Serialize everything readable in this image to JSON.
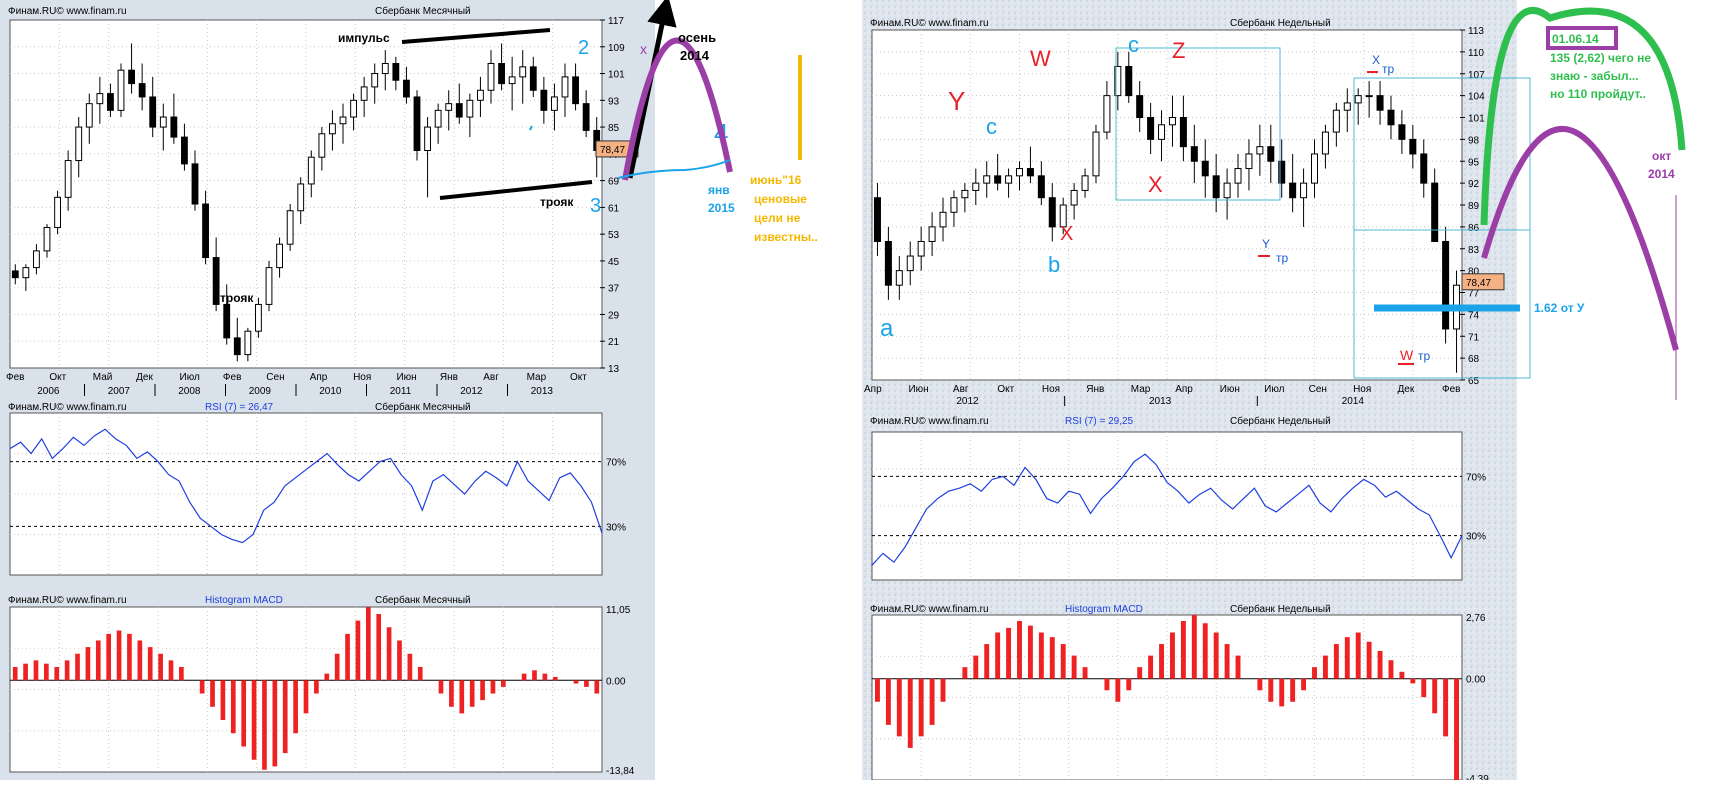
{
  "left": {
    "watermark": "Финам.RU©  www.finam.ru",
    "title": "Сбербанк Месячный",
    "price_ticks": [
      "117",
      "109",
      "101",
      "93",
      "85",
      "77",
      "69",
      "61",
      "53",
      "45",
      "37",
      "29",
      "21",
      "13"
    ],
    "last_price": "78,47",
    "month_labels": [
      "Фев",
      "Окт",
      "Май",
      "Дек",
      "Июл",
      "Фев",
      "Сен",
      "Апр",
      "Ноя",
      "Июн",
      "Янв",
      "Авг",
      "Мар",
      "Окт"
    ],
    "year_labels": [
      "2006",
      "2007",
      "2008",
      "2009",
      "2010",
      "2011",
      "2012",
      "2013"
    ],
    "rsi_title": "RSI (7) = 26,47",
    "rsi_ticks": [
      "70%",
      "30%"
    ],
    "macd_title": "Histogram MACD",
    "macd_ticks": [
      "11,05",
      "0.00",
      "-13,84"
    ]
  },
  "right": {
    "watermark": "Финам.RU©  www.finam.ru",
    "title": "Сбербанк Недельный",
    "price_ticks": [
      "113",
      "110",
      "107",
      "104",
      "101",
      "98",
      "95",
      "92",
      "89",
      "86",
      "83",
      "80",
      "77",
      "74",
      "71",
      "68",
      "65"
    ],
    "last_price": "78,47",
    "month_labels": [
      "Апр",
      "Июн",
      "Авг",
      "Окт",
      "Ноя",
      "Янв",
      "Мар",
      "Апр",
      "Июн",
      "Июл",
      "Сен",
      "Ноя",
      "Дек",
      "Фев"
    ],
    "year_labels": [
      "2012",
      "2013",
      "2014"
    ],
    "rsi_title": "RSI (7) = 29,25",
    "rsi_ticks": [
      "70%",
      "30%"
    ],
    "macd_title": "Histogram MACD",
    "macd_ticks": [
      "2,76",
      "0.00",
      "-4,39"
    ]
  },
  "annotations": {
    "impulse": "импульс",
    "troyak1": "трояк",
    "troyak2": "трояк",
    "autumn": "осень",
    "autumn_year": "2014",
    "x_mark": "x",
    "jan": "янв",
    "jan_year": "2015",
    "june_text": [
      "июнь\"16",
      "ценовые",
      "цели не",
      "известны.."
    ],
    "wave_labels_left": [
      "2",
      "3",
      "4"
    ],
    "right_date": "01.06.14",
    "right_note": [
      "135 (2,62) чего не",
      "знаю - забыл...",
      "но 110 пройдут.."
    ],
    "fib_note": "1.62 от У",
    "oct": "окт",
    "oct_year": "2014",
    "x_tr": "X",
    "y_tr": "Y",
    "w_tr": "W",
    "tr": "тр",
    "wave_labels_right": [
      "Y",
      "W",
      "Z",
      "X",
      "X"
    ],
    "blue_labels_right": [
      "c",
      "c",
      "b",
      "a"
    ]
  },
  "colors": {
    "black": "#000000",
    "purple": "#9b3fa6",
    "blue": "#1aa3e8",
    "green": "#2fbf4f",
    "orange": "#f5b800",
    "red": "#e8202a",
    "macd": "#ee2222",
    "rsi": "#1f3fdf",
    "price_box": "#f4b183"
  },
  "chart_data": [
    {
      "type": "candlestick",
      "title": "Сбербанк Месячный",
      "yrange": [
        13,
        117
      ],
      "last": 78.47,
      "ohlc": [
        [
          42,
          44,
          38,
          40
        ],
        [
          40,
          44,
          36,
          43
        ],
        [
          43,
          50,
          41,
          48
        ],
        [
          48,
          56,
          46,
          55
        ],
        [
          55,
          66,
          53,
          64
        ],
        [
          64,
          78,
          60,
          75
        ],
        [
          75,
          88,
          70,
          85
        ],
        [
          85,
          95,
          80,
          92
        ],
        [
          92,
          100,
          86,
          95
        ],
        [
          95,
          98,
          88,
          90
        ],
        [
          90,
          104,
          88,
          102
        ],
        [
          102,
          110,
          95,
          98
        ],
        [
          98,
          104,
          90,
          94
        ],
        [
          94,
          100,
          82,
          85
        ],
        [
          85,
          92,
          78,
          88
        ],
        [
          88,
          95,
          80,
          82
        ],
        [
          82,
          86,
          72,
          74
        ],
        [
          74,
          78,
          60,
          62
        ],
        [
          62,
          66,
          44,
          46
        ],
        [
          46,
          52,
          30,
          32
        ],
        [
          32,
          38,
          20,
          22
        ],
        [
          22,
          28,
          15,
          17
        ],
        [
          17,
          25,
          15,
          24
        ],
        [
          24,
          34,
          22,
          32
        ],
        [
          32,
          45,
          30,
          43
        ],
        [
          43,
          52,
          40,
          50
        ],
        [
          50,
          62,
          48,
          60
        ],
        [
          60,
          70,
          56,
          68
        ],
        [
          68,
          78,
          64,
          76
        ],
        [
          76,
          85,
          72,
          83
        ],
        [
          83,
          90,
          78,
          86
        ],
        [
          86,
          92,
          80,
          88
        ],
        [
          88,
          95,
          84,
          93
        ],
        [
          93,
          100,
          88,
          97
        ],
        [
          97,
          104,
          92,
          101
        ],
        [
          101,
          108,
          96,
          104
        ],
        [
          104,
          106,
          96,
          99
        ],
        [
          99,
          103,
          92,
          94
        ],
        [
          94,
          96,
          75,
          78
        ],
        [
          78,
          88,
          64,
          85
        ],
        [
          85,
          92,
          80,
          90
        ],
        [
          90,
          96,
          84,
          92
        ],
        [
          92,
          98,
          86,
          88
        ],
        [
          88,
          95,
          82,
          93
        ],
        [
          93,
          100,
          88,
          96
        ],
        [
          96,
          108,
          92,
          104
        ],
        [
          104,
          110,
          96,
          98
        ],
        [
          98,
          106,
          90,
          100
        ],
        [
          100,
          108,
          92,
          103
        ],
        [
          103,
          106,
          94,
          96
        ],
        [
          96,
          100,
          86,
          90
        ],
        [
          90,
          98,
          84,
          94
        ],
        [
          94,
          104,
          88,
          100
        ],
        [
          100,
          104,
          90,
          92
        ],
        [
          92,
          96,
          82,
          84
        ],
        [
          84,
          88,
          70,
          78
        ]
      ]
    },
    {
      "type": "line",
      "title": "RSI (7) = 26,47",
      "yrange": [
        0,
        100
      ],
      "values": [
        78,
        82,
        75,
        84,
        72,
        78,
        85,
        80,
        86,
        90,
        84,
        80,
        72,
        76,
        70,
        62,
        58,
        45,
        35,
        30,
        25,
        22,
        20,
        25,
        40,
        45,
        55,
        60,
        65,
        70,
        75,
        68,
        62,
        58,
        64,
        70,
        72,
        62,
        55,
        40,
        58,
        62,
        56,
        50,
        58,
        64,
        60,
        55,
        70,
        58,
        52,
        46,
        60,
        63,
        55,
        45,
        26
      ]
    },
    {
      "type": "bar",
      "title": "Histogram MACD",
      "yrange": [
        -13.84,
        11.05
      ],
      "values": [
        2,
        2.5,
        3,
        2.5,
        2,
        3,
        4,
        5,
        6,
        7,
        7.5,
        7,
        6,
        5,
        4,
        3,
        2,
        0,
        -2,
        -4,
        -6,
        -8,
        -10,
        -12,
        -13.5,
        -13,
        -11,
        -8,
        -5,
        -2,
        1,
        4,
        7,
        9,
        11,
        10,
        8,
        6,
        4,
        2,
        0,
        -2,
        -4,
        -5,
        -4,
        -3,
        -2,
        -1,
        0,
        1,
        1.5,
        1,
        0.5,
        0,
        -0.5,
        -1,
        -2
      ]
    },
    {
      "type": "candlestick",
      "title": "Сбербанк Недельный",
      "yrange": [
        65,
        113
      ],
      "last": 78.47,
      "ohlc": [
        [
          90,
          92,
          82,
          84
        ],
        [
          84,
          86,
          76,
          78
        ],
        [
          78,
          82,
          76,
          80
        ],
        [
          80,
          84,
          78,
          82
        ],
        [
          82,
          86,
          80,
          84
        ],
        [
          84,
          88,
          82,
          86
        ],
        [
          86,
          90,
          84,
          88
        ],
        [
          88,
          91,
          86,
          90
        ],
        [
          90,
          92,
          88,
          91
        ],
        [
          91,
          94,
          89,
          92
        ],
        [
          92,
          95,
          90,
          93
        ],
        [
          93,
          96,
          91,
          92
        ],
        [
          92,
          94,
          90,
          93
        ],
        [
          93,
          95,
          91,
          94
        ],
        [
          94,
          97,
          92,
          93
        ],
        [
          93,
          95,
          89,
          90
        ],
        [
          90,
          92,
          84,
          86
        ],
        [
          86,
          90,
          85,
          89
        ],
        [
          89,
          92,
          87,
          91
        ],
        [
          91,
          94,
          90,
          93
        ],
        [
          93,
          100,
          92,
          99
        ],
        [
          99,
          106,
          98,
          104
        ],
        [
          104,
          110,
          102,
          108
        ],
        [
          108,
          110,
          103,
          104
        ],
        [
          104,
          106,
          99,
          101
        ],
        [
          101,
          103,
          96,
          98
        ],
        [
          98,
          102,
          95,
          100
        ],
        [
          100,
          104,
          97,
          101
        ],
        [
          101,
          104,
          95,
          97
        ],
        [
          97,
          100,
          92,
          95
        ],
        [
          95,
          98,
          90,
          93
        ],
        [
          93,
          96,
          88,
          90
        ],
        [
          90,
          94,
          87,
          92
        ],
        [
          92,
          96,
          90,
          94
        ],
        [
          94,
          98,
          91,
          96
        ],
        [
          96,
          100,
          93,
          97
        ],
        [
          97,
          100,
          92,
          95
        ],
        [
          95,
          98,
          90,
          92
        ],
        [
          92,
          96,
          88,
          90
        ],
        [
          90,
          94,
          86,
          92
        ],
        [
          92,
          98,
          90,
          96
        ],
        [
          96,
          100,
          94,
          99
        ],
        [
          99,
          103,
          97,
          102
        ],
        [
          102,
          105,
          99,
          103
        ],
        [
          103,
          105,
          100,
          104
        ],
        [
          104,
          106,
          101,
          104
        ],
        [
          104,
          106,
          100,
          102
        ],
        [
          102,
          104,
          98,
          100
        ],
        [
          100,
          102,
          96,
          98
        ],
        [
          98,
          100,
          94,
          96
        ],
        [
          96,
          98,
          90,
          92
        ],
        [
          92,
          94,
          86,
          84
        ],
        [
          84,
          86,
          70,
          72
        ],
        [
          72,
          80,
          66,
          78
        ]
      ]
    },
    {
      "type": "line",
      "title": "RSI (7) = 29,25",
      "yrange": [
        0,
        100
      ],
      "values": [
        10,
        18,
        12,
        22,
        35,
        48,
        55,
        60,
        62,
        65,
        60,
        68,
        70,
        64,
        76,
        68,
        55,
        52,
        60,
        58,
        45,
        55,
        62,
        70,
        80,
        85,
        78,
        66,
        60,
        52,
        58,
        62,
        54,
        48,
        55,
        62,
        50,
        46,
        52,
        58,
        64,
        52,
        46,
        55,
        62,
        68,
        64,
        56,
        60,
        54,
        48,
        44,
        30,
        15,
        30
      ]
    },
    {
      "type": "bar",
      "title": "Histogram MACD",
      "yrange": [
        -4.39,
        2.76
      ],
      "values": [
        -1,
        -2,
        -2.5,
        -3,
        -2.5,
        -2,
        -1,
        0,
        0.5,
        1,
        1.5,
        2,
        2.2,
        2.5,
        2.3,
        2,
        1.8,
        1.5,
        1,
        0.5,
        0,
        -0.5,
        -1,
        -0.5,
        0.5,
        1,
        1.5,
        2,
        2.5,
        2.76,
        2.4,
        2,
        1.5,
        1,
        0,
        -0.5,
        -1,
        -1.2,
        -1,
        -0.5,
        0.5,
        1,
        1.5,
        1.8,
        2,
        1.6,
        1.2,
        0.8,
        0.3,
        -0.2,
        -0.8,
        -1.5,
        -2.5,
        -4.39
      ]
    }
  ]
}
